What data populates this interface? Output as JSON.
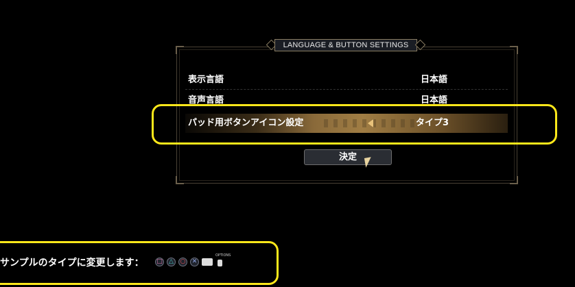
{
  "dialog": {
    "title": "LANGUAGE & BUTTON SETTINGS",
    "rows": [
      {
        "label": "表示言語",
        "value": "日本語"
      },
      {
        "label": "音声言語",
        "value": "日本語"
      },
      {
        "label": "パッド用ボタンアイコン設定",
        "value": "タイプ3"
      }
    ],
    "confirm_label": "決定"
  },
  "hint": {
    "text": "サンプルのタイプに変更します：",
    "icons": [
      "square-button-icon",
      "triangle-button-icon",
      "circle-button-icon",
      "cross-button-icon",
      "touchpad-icon",
      "options-button-icon"
    ],
    "options_label": "OPTIONS"
  },
  "colors": {
    "highlight": "#ffe81a",
    "selected_row": "#a07d44",
    "accent": "#e8c27a"
  }
}
